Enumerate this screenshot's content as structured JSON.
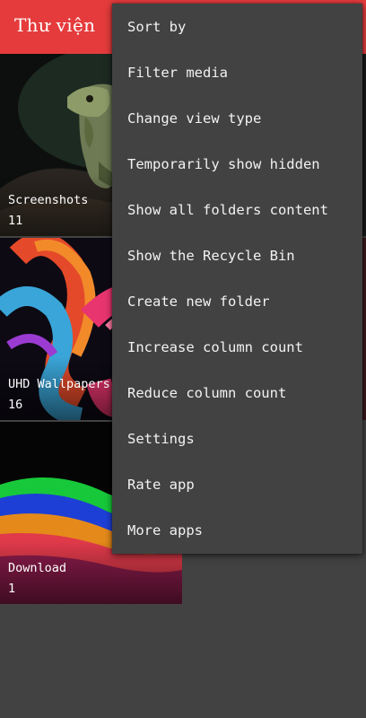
{
  "app_bar": {
    "title": "Thư viện",
    "background_color": "#e53b3c"
  },
  "folders": [
    {
      "name": "Screenshots",
      "count": "11",
      "thumbnail": "lizard-photo"
    },
    {
      "name": "UHD Wallpapers",
      "count": "16",
      "thumbnail": "abstract-wave-wallpaper"
    },
    {
      "name": "Download",
      "count": "1",
      "thumbnail": "colored-waves-image"
    }
  ],
  "overflow_menu": {
    "items": [
      "Sort by",
      "Filter media",
      "Change view type",
      "Temporarily show hidden",
      "Show all folders content",
      "Show the Recycle Bin",
      "Create new folder",
      "Increase column count",
      "Reduce column count",
      "Settings",
      "Rate app",
      "More apps"
    ]
  }
}
